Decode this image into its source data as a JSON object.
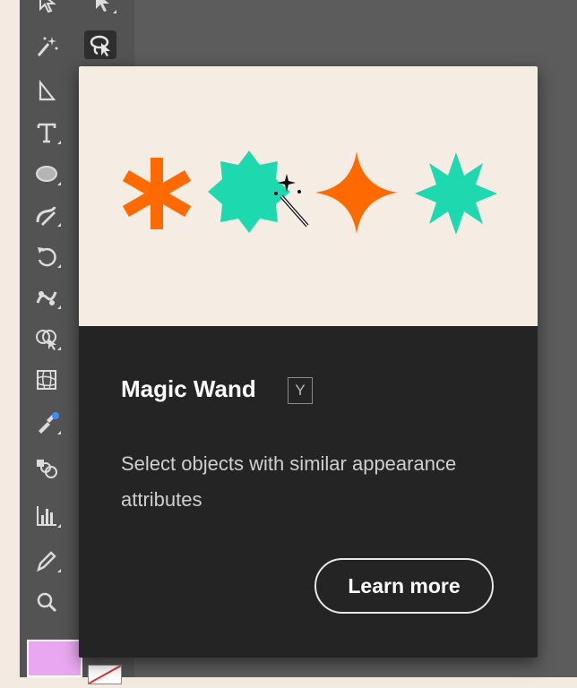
{
  "tooltip": {
    "title": "Magic Wand",
    "shortcut": "Y",
    "description": "Select objects with similar appearance attributes",
    "learn_more": "Learn more"
  },
  "colors": {
    "orange": "#ff6a00",
    "teal": "#1ed9b0",
    "preview_bg": "#f5ede3",
    "tooltip_bg": "#242424",
    "fill_swatch": "#e9a7f2"
  },
  "toolbar_icons": [
    "selection-icon",
    "direct-selection-icon",
    "magic-wand-icon",
    "lasso-icon",
    "pen-icon",
    "type-icon",
    "ellipse-icon",
    "paintbrush-icon",
    "rotate-icon",
    "puppet-warp-icon",
    "shape-builder-icon",
    "mesh-icon",
    "eyedropper-icon",
    "blend-icon",
    "graph-icon",
    "pencil-icon",
    "zoom-icon"
  ]
}
